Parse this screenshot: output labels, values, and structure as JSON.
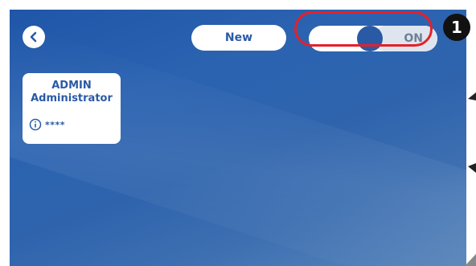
{
  "header": {
    "back_icon": "chevron-left-icon",
    "new_label": "New",
    "toggle": {
      "state": "ON",
      "on": true
    }
  },
  "users": [
    {
      "id": "ADMIN",
      "role": "Administrator",
      "info_icon": "info-icon",
      "pin": "****"
    }
  ],
  "annotation": {
    "marker": "1",
    "highlight_color": "#e42129"
  },
  "colors": {
    "accent": "#2a5aa6",
    "background": "#2b63b1"
  }
}
